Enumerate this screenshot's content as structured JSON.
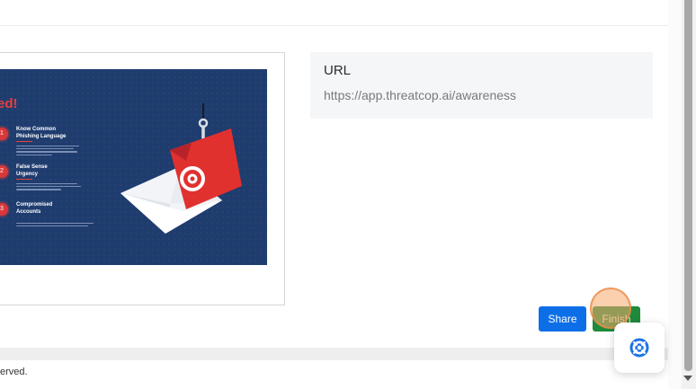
{
  "slide": {
    "heading": "ed!",
    "tips": [
      {
        "number": "1",
        "title_lines": [
          "Know Common",
          "Phishing Language"
        ]
      },
      {
        "number": "2",
        "title_lines": [
          "False Sense",
          "Urgency"
        ]
      },
      {
        "number": "3",
        "title_lines": [
          "Compromised",
          "Accounts"
        ]
      }
    ]
  },
  "url_card": {
    "label": "URL",
    "value": "https://app.threatcop.ai/awareness"
  },
  "actions": {
    "share_label": "Share",
    "finish_label": "Finish"
  },
  "footer": {
    "text": "erved."
  },
  "colors": {
    "slide_bg": "#1f3c6e",
    "accent_red": "#e8413a",
    "share_blue": "#0d6fe8",
    "finish_green": "#1f8a3c",
    "help_icon_blue": "#1a73e8"
  },
  "icons": {
    "help": "lifebuoy-icon",
    "slide_graphic": "phishing-hook-envelope-icon"
  }
}
